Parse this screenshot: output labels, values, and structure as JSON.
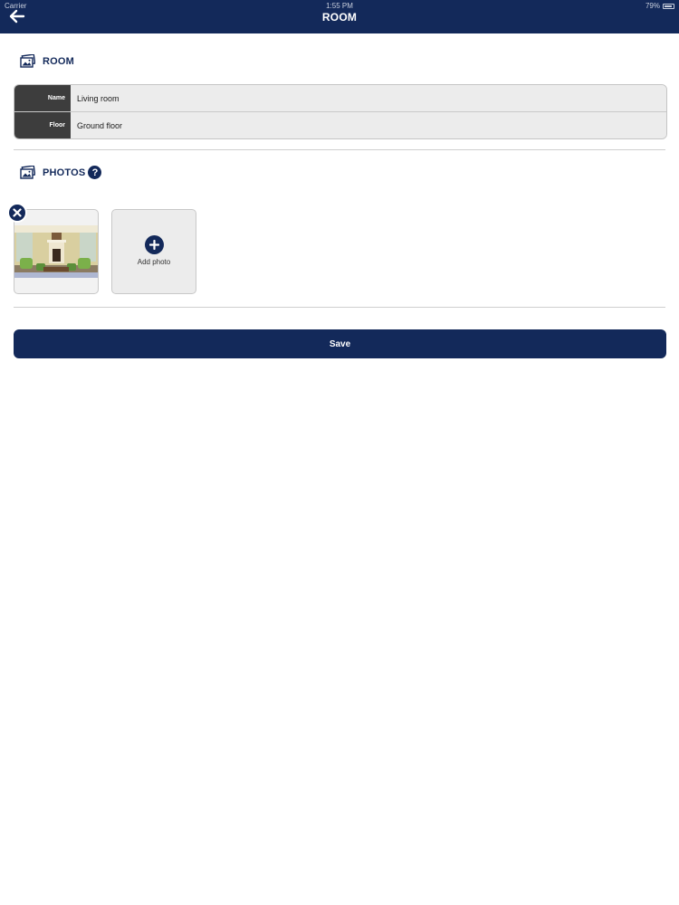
{
  "status_bar": {
    "carrier": "Carrier",
    "time": "1:55 PM",
    "battery": "79%"
  },
  "header": {
    "title": "ROOM",
    "back_icon": "arrow-left-icon"
  },
  "room_section": {
    "heading": "ROOM",
    "icon": "photo-icon",
    "fields": [
      {
        "label": "Name",
        "value": "Living room"
      },
      {
        "label": "Floor",
        "value": "Ground floor"
      }
    ]
  },
  "photos_section": {
    "heading": "PHOTOS",
    "icon": "photo-icon",
    "help_label": "?",
    "photos_count": 1,
    "add_photo_label": "Add photo"
  },
  "save_label": "Save",
  "colors": {
    "primary": "#13295a",
    "label_bg": "#3d3d3d",
    "field_bg": "#ececec"
  }
}
